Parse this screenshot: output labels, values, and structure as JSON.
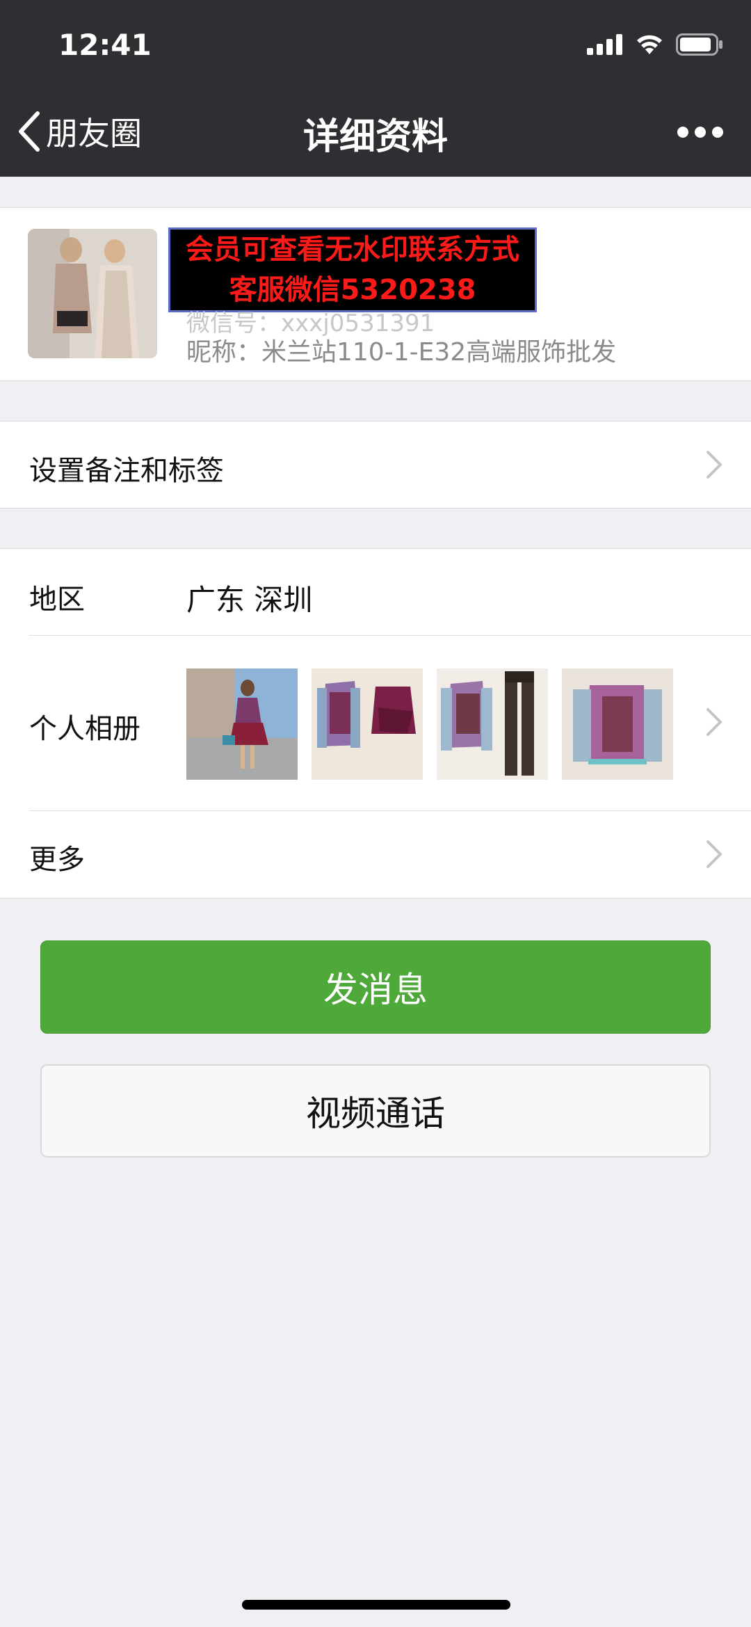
{
  "status_bar": {
    "time": "12:41"
  },
  "nav": {
    "back_label": "朋友圈",
    "title": "详细资料"
  },
  "profile": {
    "watermark_line1": "会员可查看无水印联系方式",
    "watermark_line2": "客服微信5320238",
    "wechat_id": "微信号：xxxj0531391",
    "nickname": "昵称：米兰站110-1-E32高端服饰批发"
  },
  "remark": {
    "label": "设置备注和标签"
  },
  "info": {
    "region_label": "地区",
    "region_value": "广东 深圳",
    "album_label": "个人相册",
    "more_label": "更多"
  },
  "actions": {
    "send_message": "发消息",
    "video_call": "视频通话"
  },
  "colors": {
    "nav_bg": "#2f2f33",
    "primary_green": "#4ea93a",
    "page_bg": "#efeff4",
    "watermark_text": "#ff1a1a"
  }
}
